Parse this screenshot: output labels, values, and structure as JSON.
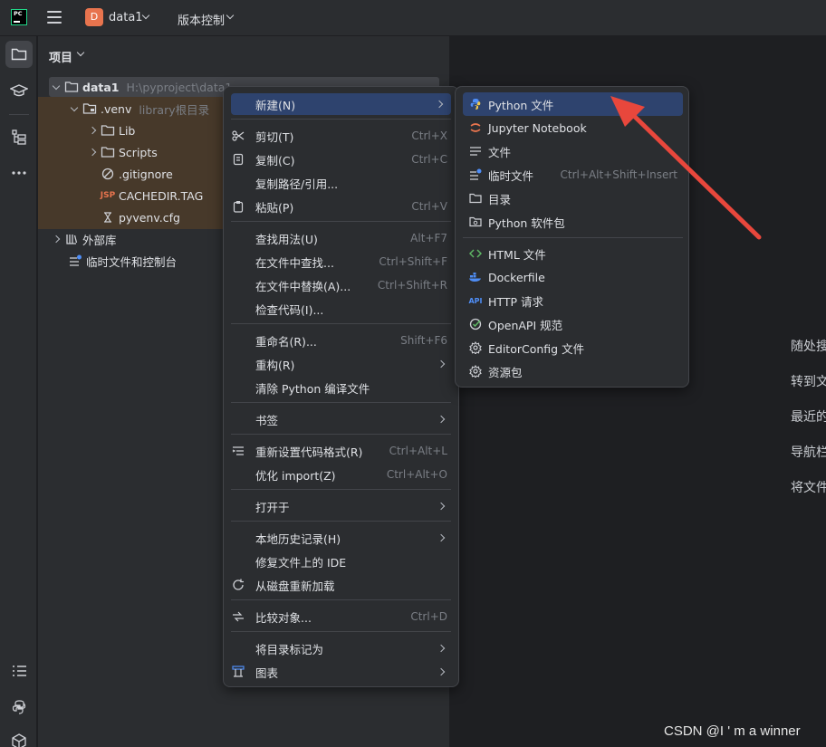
{
  "titlebar": {
    "logo_text": "PC",
    "project_badge": "D",
    "project_name": "data1",
    "vcs_label": "版本控制"
  },
  "stripe": {
    "icons": [
      "folder-icon",
      "learn-icon",
      "structure-icon",
      "more-icon",
      "todo-icon",
      "python-packages-icon",
      "services-icon"
    ]
  },
  "project_panel": {
    "title": "项目",
    "tree": [
      {
        "label": "data1",
        "hint": "H:\\pyproject\\data1"
      },
      {
        "label": ".venv",
        "hint": "library根目录"
      },
      {
        "label": "Lib"
      },
      {
        "label": "Scripts"
      },
      {
        "label": ".gitignore"
      },
      {
        "label": "CACHEDIR.TAG",
        "icon_text": "JSP"
      },
      {
        "label": "pyvenv.cfg"
      },
      {
        "label": "外部库"
      },
      {
        "label": "临时文件和控制台"
      }
    ]
  },
  "context_menu": {
    "items": [
      {
        "label": "新建(N)",
        "shortcut": ""
      },
      {
        "label": "剪切(T)",
        "shortcut": "Ctrl+X"
      },
      {
        "label": "复制(C)",
        "shortcut": "Ctrl+C"
      },
      {
        "label": "复制路径/引用...",
        "shortcut": ""
      },
      {
        "label": "粘贴(P)",
        "shortcut": "Ctrl+V"
      },
      {
        "label": "查找用法(U)",
        "shortcut": "Alt+F7"
      },
      {
        "label": "在文件中查找...",
        "shortcut": "Ctrl+Shift+F"
      },
      {
        "label": "在文件中替换(A)...",
        "shortcut": "Ctrl+Shift+R"
      },
      {
        "label": "检查代码(I)...",
        "shortcut": ""
      },
      {
        "label": "重命名(R)...",
        "shortcut": "Shift+F6"
      },
      {
        "label": "重构(R)",
        "shortcut": ""
      },
      {
        "label": "清除 Python 编译文件",
        "shortcut": ""
      },
      {
        "label": "书签",
        "shortcut": ""
      },
      {
        "label": "重新设置代码格式(R)",
        "shortcut": "Ctrl+Alt+L"
      },
      {
        "label": "优化 import(Z)",
        "shortcut": "Ctrl+Alt+O"
      },
      {
        "label": "打开于",
        "shortcut": ""
      },
      {
        "label": "本地历史记录(H)",
        "shortcut": ""
      },
      {
        "label": "修复文件上的 IDE",
        "shortcut": ""
      },
      {
        "label": "从磁盘重新加载",
        "shortcut": ""
      },
      {
        "label": "比较对象...",
        "shortcut": "Ctrl+D"
      },
      {
        "label": "将目录标记为",
        "shortcut": ""
      },
      {
        "label": "图表",
        "shortcut": ""
      }
    ]
  },
  "new_submenu": {
    "items": [
      {
        "label": "Python 文件",
        "shortcut": ""
      },
      {
        "label": "Jupyter Notebook",
        "shortcut": ""
      },
      {
        "label": "文件",
        "shortcut": ""
      },
      {
        "label": "临时文件",
        "shortcut": "Ctrl+Alt+Shift+Insert"
      },
      {
        "label": "目录",
        "shortcut": ""
      },
      {
        "label": "Python 软件包",
        "shortcut": ""
      },
      {
        "label": "HTML 文件",
        "shortcut": ""
      },
      {
        "label": "Dockerfile",
        "shortcut": ""
      },
      {
        "label": "HTTP 请求",
        "shortcut": "",
        "icon_text": "API"
      },
      {
        "label": "OpenAPI 规范",
        "shortcut": ""
      },
      {
        "label": "EditorConfig 文件",
        "shortcut": ""
      },
      {
        "label": "资源包",
        "shortcut": ""
      }
    ]
  },
  "editor_hints": [
    "随处搜",
    "转到文",
    "最近的",
    "导航栏",
    "将文件"
  ],
  "watermark": "CSDN @I ' m a winner",
  "colors": {
    "selection": "#2e436e",
    "highlight_folder": "#47392a",
    "annotation_arrow": "#e8473c"
  }
}
